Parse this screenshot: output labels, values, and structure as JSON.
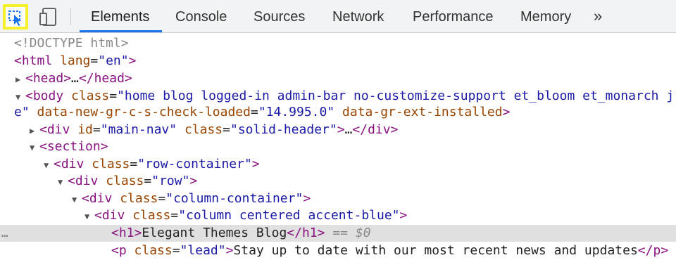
{
  "toolbar": {
    "tabs": [
      {
        "label": "Elements",
        "active": true
      },
      {
        "label": "Console"
      },
      {
        "label": "Sources"
      },
      {
        "label": "Network"
      },
      {
        "label": "Performance"
      },
      {
        "label": "Memory"
      }
    ],
    "more_label": "»",
    "icons": [
      "inspect-element-icon",
      "device-toolbar-icon"
    ],
    "accent_color": "#1a73e8",
    "highlight_color": "#f4f12a"
  },
  "dom_tree": {
    "doctype": "<!DOCTYPE html>",
    "html_tag": "html",
    "html_attr": "lang",
    "html_val": "\"en\"",
    "head_tag": "head",
    "collapsed_ellipsis": "…",
    "body_tag": "body",
    "body_class_attr": "class",
    "body_class_val_1": "\"home blog logged-in admin-bar no-customize-support et_bloom et_monarch j",
    "body_class_val_2": "e\"",
    "body_attr2": "data-new-gr-c-s-check-loaded",
    "body_val2": "\"14.995.0\"",
    "body_attr3": "data-gr-ext-installed",
    "nav_tag": "div",
    "nav_attr1": "id",
    "nav_val1": "\"main-nav\"",
    "nav_attr2": "class",
    "nav_val2": "\"solid-header\"",
    "section_tag": "section",
    "row_container_tag": "div",
    "row_container_attr": "class",
    "row_container_val": "\"row-container\"",
    "row_tag": "div",
    "row_attr": "class",
    "row_val": "\"row\"",
    "column_container_tag": "div",
    "column_container_attr": "class",
    "column_container_val": "\"column-container\"",
    "column_tag": "div",
    "column_attr": "class",
    "column_val": "\"column centered accent-blue\"",
    "h1_tag": "h1",
    "h1_text": "Elegant Themes Blog",
    "selected_marker": "== $0",
    "row_dots": "…",
    "p_tag": "p",
    "p_attr": "class",
    "p_val": "\"lead\"",
    "p_text": "Stay up to date with our most recent news and updates"
  }
}
